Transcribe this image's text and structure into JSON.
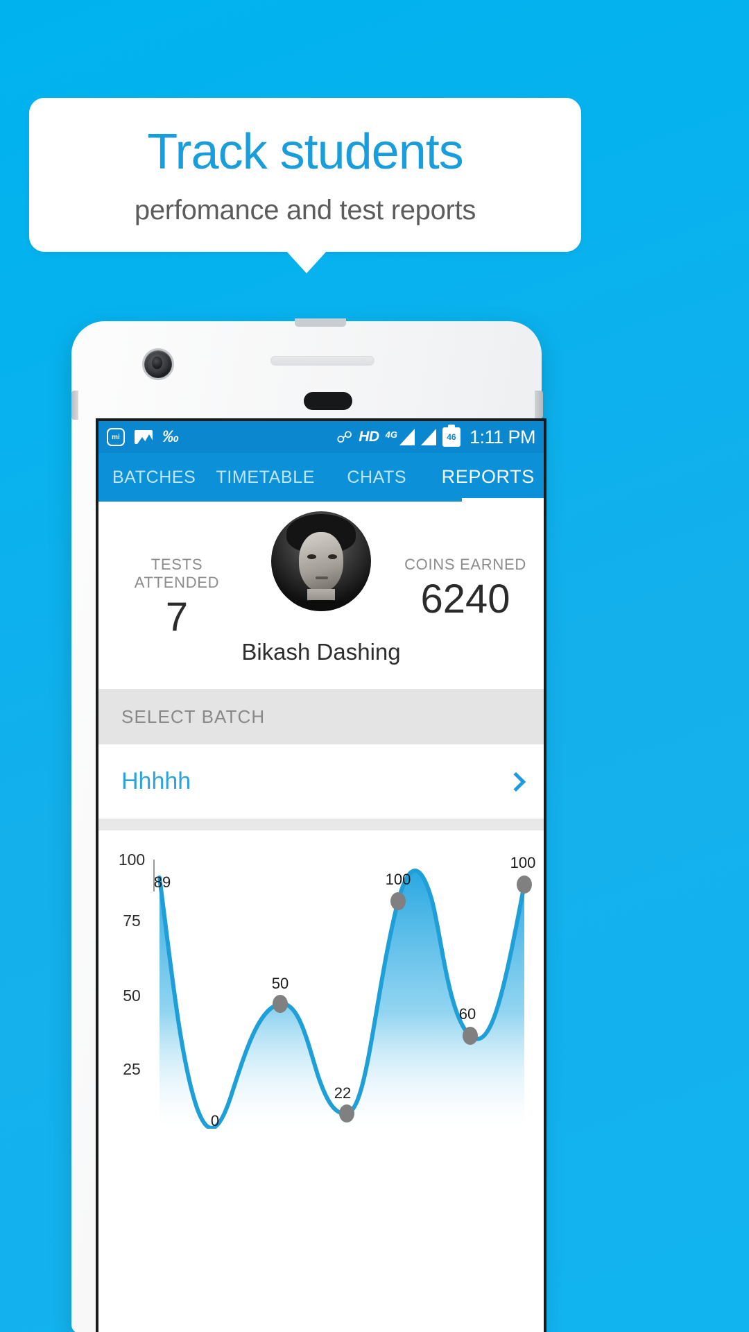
{
  "promo": {
    "headline": "Track students",
    "subhead": "perfomance and test reports",
    "headline_color": "#1a9ddb",
    "background_color": "#0fb2ee"
  },
  "statusbar": {
    "icons_left": [
      "mi-icon",
      "gallery-icon",
      "sync-disabled-icon"
    ],
    "mi_label": "mi",
    "sync_glyph": "ẞ",
    "bluetooth_glyph": "ᛗ",
    "hd_label": "HD",
    "network_label": "4G",
    "battery_level": "46",
    "time": "1:11 PM"
  },
  "tabs": [
    {
      "label": "BATCHES",
      "active": false
    },
    {
      "label": "TIMETABLE",
      "active": false
    },
    {
      "label": "CHATS",
      "active": false
    },
    {
      "label": "REPORTS",
      "active": true
    }
  ],
  "profile": {
    "tests_attended_label": "TESTS ATTENDED",
    "tests_attended_value": "7",
    "coins_earned_label": "COINS EARNED",
    "coins_earned_value": "6240",
    "name": "Bikash Dashing"
  },
  "batch": {
    "section_label": "SELECT BATCH",
    "selected": "Hhhhh",
    "chevron": "chevron-right-icon"
  },
  "chart_data": {
    "type": "area",
    "title": "",
    "xlabel": "",
    "ylabel": "",
    "ylim": [
      0,
      100
    ],
    "yticks": [
      100,
      75,
      50,
      25
    ],
    "grid": false,
    "legend": false,
    "x": [
      1,
      2,
      3,
      4,
      5,
      6,
      7
    ],
    "values": [
      89,
      0,
      50,
      22,
      100,
      60,
      100
    ],
    "point_labels": [
      "89",
      "0",
      "50",
      "22",
      "100",
      "60",
      "100"
    ],
    "line_color": "#1f9fd8",
    "fill_top_color": "#2aa8e2",
    "fill_bottom_color": "#ffffff",
    "marker_color": "#808080"
  }
}
